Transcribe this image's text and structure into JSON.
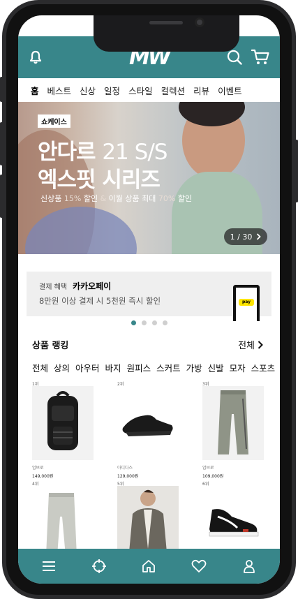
{
  "header": {
    "logo": "MW",
    "icons": [
      "bell-icon",
      "search-icon",
      "cart-icon"
    ]
  },
  "nav": {
    "items": [
      "홈",
      "베스트",
      "신상",
      "일정",
      "스타일",
      "컬렉션",
      "리뷰",
      "이벤트"
    ],
    "active_index": 0
  },
  "banner": {
    "tag": "쇼케이스",
    "title_bold": "안다르",
    "title_light": "21 S/S",
    "title_line2": "엑스핏 시리즈",
    "sub_a": "신상품",
    "sub_b": "15%",
    "sub_c": "할인",
    "sub_d": "&",
    "sub_e": "이월 상품 최대",
    "sub_f": "70%",
    "sub_g": "할인",
    "counter": "1 / 30"
  },
  "payment": {
    "label": "결제 혜택",
    "brand": "카카오페이",
    "desc": "8만원 이상 결제 시 5천원 즉시 할인",
    "badge": "pay"
  },
  "carousel": {
    "count": 4,
    "active": 0
  },
  "ranking": {
    "title": "상품 랭킹",
    "all_label": "전체",
    "categories": [
      "전체",
      "상의",
      "아우터",
      "바지",
      "원피스",
      "스커트",
      "가방",
      "신발",
      "모자",
      "스포츠"
    ],
    "products": [
      {
        "rank": "1위",
        "brand": "엄브로",
        "price": "149,000원",
        "icon": "backpack-icon"
      },
      {
        "rank": "2위",
        "brand": "아디다스",
        "price": "129,000원",
        "icon": "sneaker-icon"
      },
      {
        "rank": "3위",
        "brand": "엄브로",
        "price": "109,000원",
        "icon": "jogger-pants-icon"
      },
      {
        "rank": "4위",
        "brand": "",
        "price": "",
        "icon": "sweatpants-icon"
      },
      {
        "rank": "5위",
        "brand": "",
        "price": "",
        "icon": "blazer-model-icon"
      },
      {
        "rank": "6위",
        "brand": "",
        "price": "",
        "icon": "skate-shoe-icon"
      }
    ]
  },
  "tabbar": {
    "icons": [
      "menu-icon",
      "explore-icon",
      "home-icon",
      "heart-icon",
      "user-icon"
    ]
  },
  "colors": {
    "accent": "#38868a",
    "frame": "#2b2b2d"
  }
}
